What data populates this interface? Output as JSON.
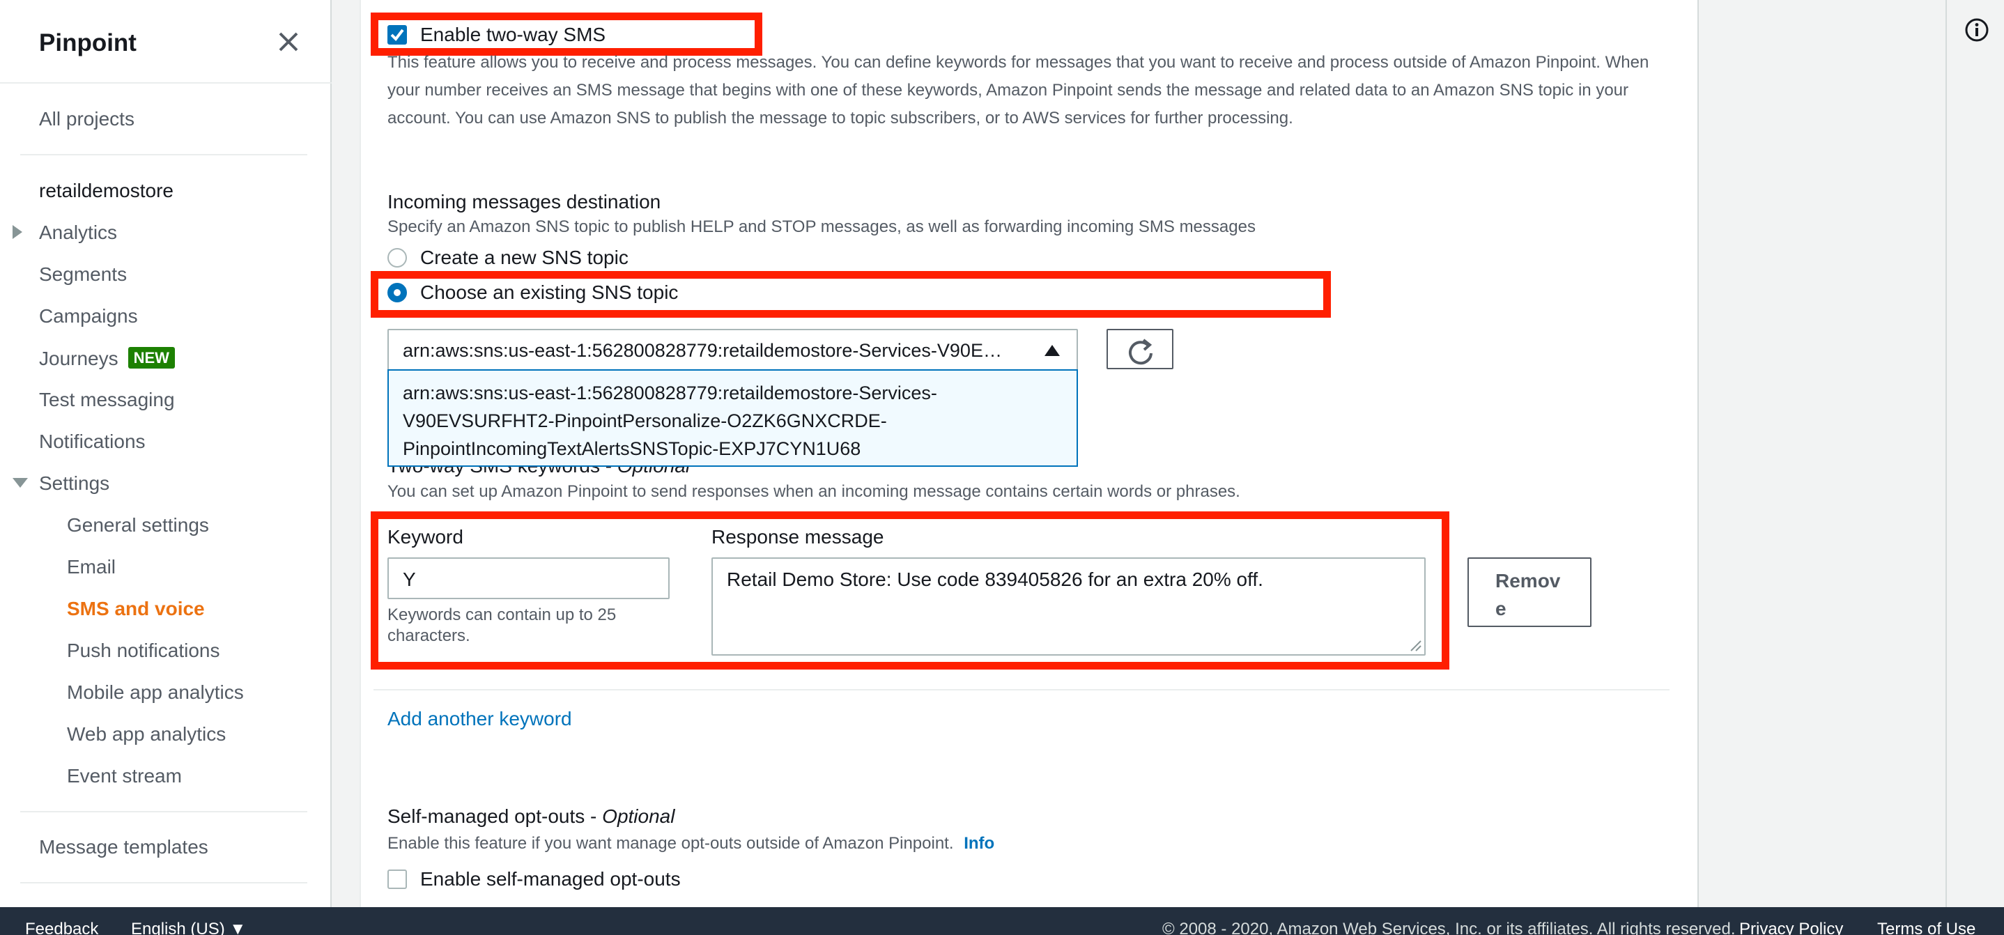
{
  "sidebar": {
    "title": "Pinpoint",
    "all_projects": "All projects",
    "project": "retaildemostore",
    "items": [
      {
        "label": "Analytics"
      },
      {
        "label": "Segments"
      },
      {
        "label": "Campaigns"
      },
      {
        "label": "Journeys",
        "badge": "NEW"
      },
      {
        "label": "Test messaging"
      },
      {
        "label": "Notifications"
      },
      {
        "label": "Settings"
      }
    ],
    "settings_items": [
      {
        "label": "General settings"
      },
      {
        "label": "Email"
      },
      {
        "label": "SMS and voice",
        "active": true
      },
      {
        "label": "Push notifications"
      },
      {
        "label": "Mobile app analytics"
      },
      {
        "label": "Web app analytics"
      },
      {
        "label": "Event stream"
      }
    ],
    "message_templates": "Message templates"
  },
  "two_way": {
    "checkbox_label": "Enable two-way SMS",
    "checked": true,
    "description": "This feature allows you to receive and process messages. You can define keywords for messages that you want to receive and process outside of Amazon Pinpoint. When your number receives an SMS message that begins with one of these keywords, Amazon Pinpoint sends the message and related data to an Amazon SNS topic in your account. You can use Amazon SNS to publish the message to topic subscribers, or to AWS services for further processing."
  },
  "destination": {
    "heading": "Incoming messages destination",
    "description": "Specify an Amazon SNS topic to publish HELP and STOP messages, as well as forwarding incoming SMS messages",
    "option_new": "Create a new SNS topic",
    "option_existing": "Choose an existing SNS topic",
    "selected_option": "existing",
    "select_value": "arn:aws:sns:us-east-1:562800828779:retaildemostore-Services-V90E…",
    "dropdown_option": "arn:aws:sns:us-east-1:562800828779:retaildemostore-Services-V90EVSURFHT2-PinpointPersonalize-O2ZK6GNXCRDE-PinpointIncomingTextAlertsSNSTopic-EXPJ7CYN1U68"
  },
  "keywords": {
    "heading": "Two-way SMS keywords - ",
    "heading_optional": "Optional",
    "description": "You can set up Amazon Pinpoint to send responses when an incoming message contains certain words or phrases.",
    "keyword_label": "Keyword",
    "keyword_value": "Y",
    "keyword_hint": "Keywords can contain up to 25 characters.",
    "response_label": "Response message",
    "response_value": "Retail Demo Store: Use code 839405826 for an extra 20% off.",
    "remove_label": "Remove",
    "add_link": "Add another keyword"
  },
  "opt_outs": {
    "heading": "Self-managed opt-outs - ",
    "heading_optional": "Optional",
    "description": "Enable this feature if you want manage opt-outs outside of Amazon Pinpoint.",
    "info_link": "Info",
    "checkbox_label": "Enable self-managed opt-outs",
    "checked": false
  },
  "footer": {
    "feedback": "Feedback",
    "language": "English (US)",
    "copyright": "© 2008 - 2020, Amazon Web Services, Inc. or its affiliates. All rights reserved.",
    "privacy": "Privacy Policy",
    "terms": "Terms of Use"
  },
  "colors": {
    "accent": "#0073bb",
    "active_nav": "#ec7211",
    "highlight": "#ff1f00",
    "badge": "#1d8102",
    "footer_bg": "#232f3e"
  }
}
